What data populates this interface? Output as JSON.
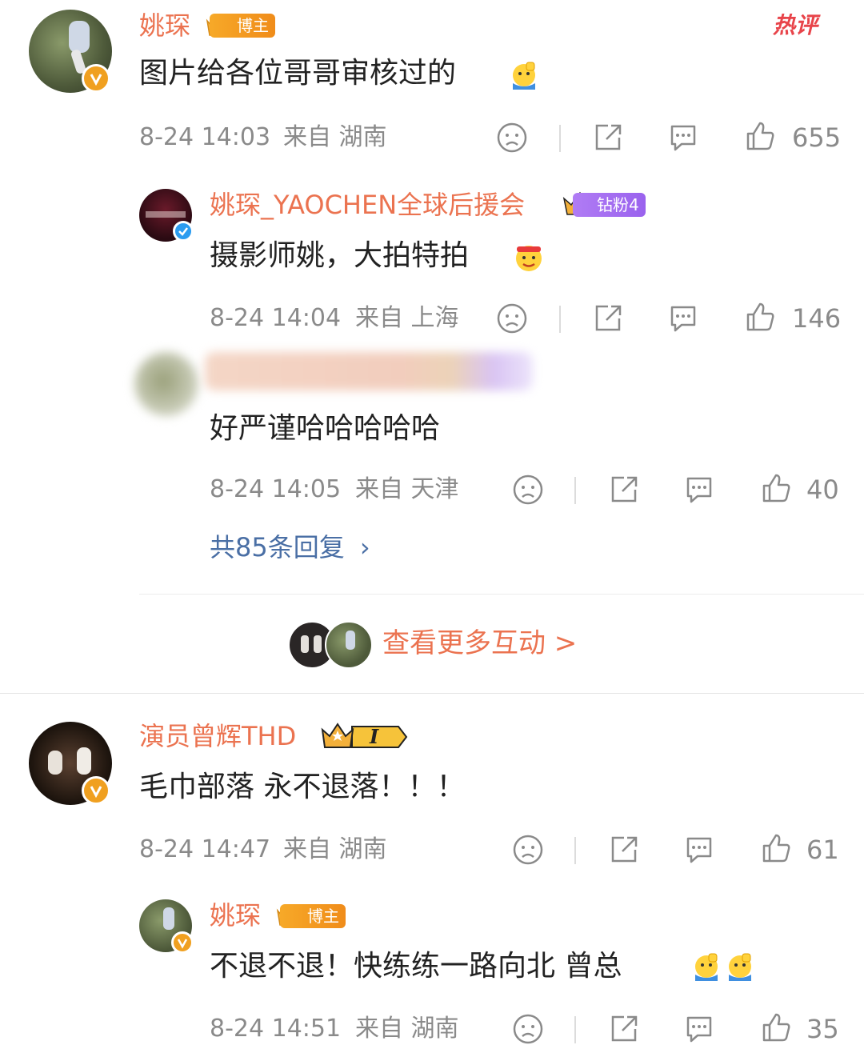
{
  "colors": {
    "username": "#eb7350",
    "link": "#4a6fa5",
    "meta": "#8a8a8a",
    "hot": "#e8444a"
  },
  "hot_badge": "热评",
  "comments": [
    {
      "username": "姚琛",
      "badge": "博主",
      "text": "图片给各位哥哥审核过的",
      "emoji": "emoji-salute-icon",
      "time": "8-24 14:03",
      "location": "来自 湖南",
      "likes": "655",
      "replies": [
        {
          "username": "姚琛_YAOCHEN全球后援会",
          "badge": "钻粉4",
          "text": "摄影师姚，大拍特拍",
          "time": "8-24 14:04",
          "location": "来自 上海",
          "likes": "146"
        },
        {
          "username": "",
          "text": "好严谨哈哈哈哈哈",
          "time": "8-24 14:05",
          "location": "来自 天津",
          "likes": "40"
        }
      ],
      "more_replies": "共85条回复",
      "more_interaction": "查看更多互动 >"
    },
    {
      "username": "演员曾辉THD",
      "badge": "I",
      "text": "毛巾部落 永不退落！！！",
      "time": "8-24 14:47",
      "location": "来自 湖南",
      "likes": "61",
      "replies": [
        {
          "username": "姚琛",
          "badge": "博主",
          "text": "不退不退！快练练一路向北 曾总",
          "time": "8-24 14:51",
          "location": "来自 湖南",
          "likes": "35"
        }
      ]
    }
  ]
}
